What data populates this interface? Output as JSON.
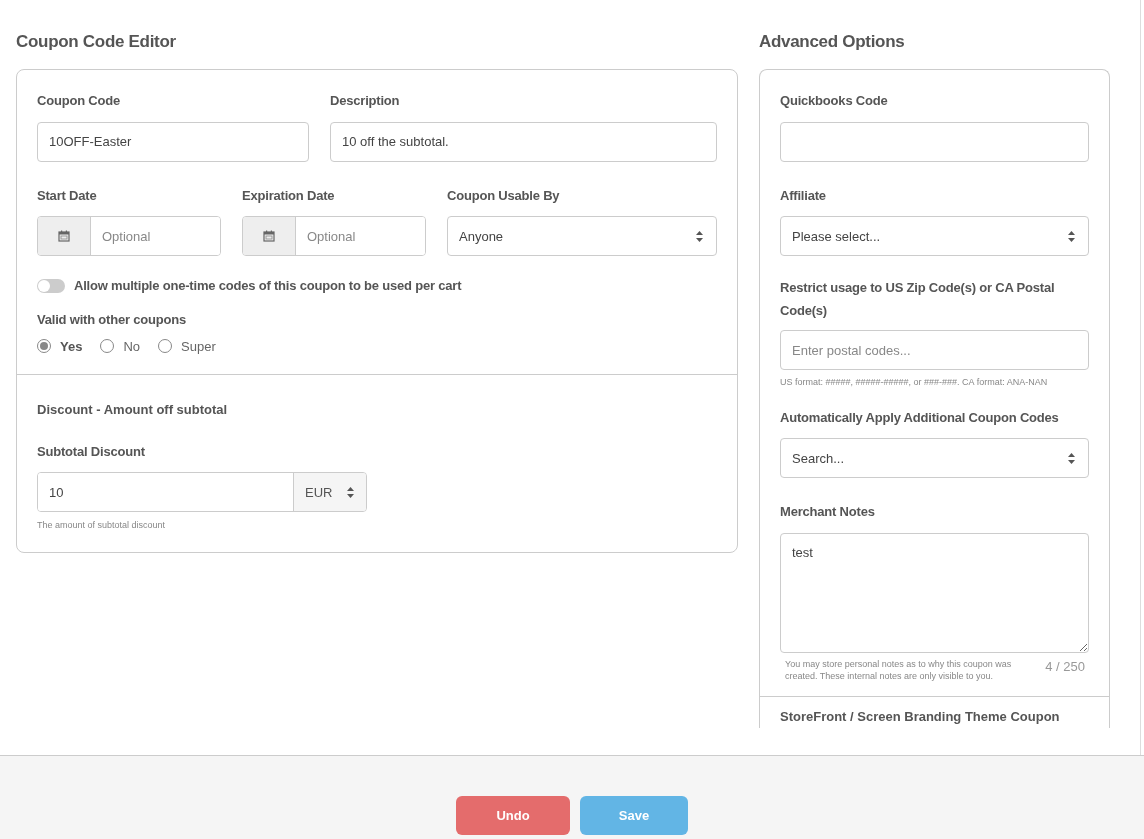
{
  "editor": {
    "title": "Coupon Code Editor",
    "coupon_code": {
      "label": "Coupon Code",
      "value": "10OFF-Easter"
    },
    "description": {
      "label": "Description",
      "value": "10 off the subtotal."
    },
    "start_date": {
      "label": "Start Date",
      "placeholder": "Optional"
    },
    "expiration_date": {
      "label": "Expiration Date",
      "placeholder": "Optional"
    },
    "usable_by": {
      "label": "Coupon Usable By",
      "value": "Anyone"
    },
    "multiple_codes_toggle": {
      "label": "Allow multiple one-time codes of this coupon to be used per cart",
      "on": false
    },
    "valid_with_other": {
      "label": "Valid with other coupons",
      "options": [
        {
          "label": "Yes",
          "selected": true
        },
        {
          "label": "No",
          "selected": false
        },
        {
          "label": "Super",
          "selected": false
        }
      ]
    },
    "discount": {
      "heading": "Discount - Amount off subtotal",
      "label": "Subtotal Discount",
      "value": "10",
      "currency": "EUR",
      "help": "The amount of subtotal discount"
    }
  },
  "advanced": {
    "title": "Advanced Options",
    "quickbooks_code": {
      "label": "Quickbooks Code"
    },
    "affiliate": {
      "label": "Affiliate",
      "value": "Please select..."
    },
    "postal_restriction": {
      "label": "Restrict usage to US Zip Code(s) or CA Postal Code(s)",
      "placeholder": "Enter postal codes...",
      "help": "US format: #####, #####-#####, or ###-###. CA format: ANA-NAN"
    },
    "additional_codes": {
      "label": "Automatically Apply Additional Coupon Codes",
      "value": "Search..."
    },
    "merchant_notes": {
      "label": "Merchant Notes",
      "value": "test",
      "help": "You may store personal notes as to why this coupon was created. These internal notes are only visible to you.",
      "counter": "4 / 250"
    },
    "next_section_title": "StoreFront / Screen Branding Theme Coupon"
  },
  "footer": {
    "buttons": [
      {
        "label": "Undo",
        "kind": "undo"
      },
      {
        "label": "Save",
        "kind": "save"
      }
    ]
  }
}
